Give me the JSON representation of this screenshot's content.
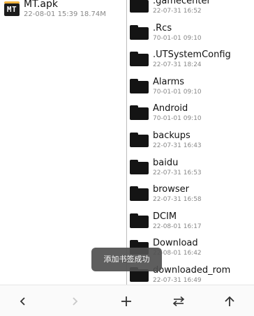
{
  "left_panel": {
    "file": {
      "name": "MT.apk",
      "meta": "22-08-01 15:39  18.74M",
      "icon": "apk-file-icon",
      "icon_text": "MT"
    }
  },
  "right_panel": {
    "folders": [
      {
        "name": ".gamecenter",
        "date": "22-07-31 16:52"
      },
      {
        "name": ".Rcs",
        "date": "70-01-01 09:10"
      },
      {
        "name": ".UTSystemConfig",
        "date": "22-07-31 18:24"
      },
      {
        "name": "Alarms",
        "date": "70-01-01 09:10"
      },
      {
        "name": "Android",
        "date": "70-01-01 09:10"
      },
      {
        "name": "backups",
        "date": "22-07-31 16:43"
      },
      {
        "name": "baidu",
        "date": "22-07-31 16:53"
      },
      {
        "name": "browser",
        "date": "22-07-31 16:58"
      },
      {
        "name": "DCIM",
        "date": "22-08-01 16:17"
      },
      {
        "name": "Download",
        "date": "22-08-01 16:42"
      },
      {
        "name": "downloaded_rom",
        "date": "22-07-31 16:49"
      }
    ]
  },
  "toast": {
    "message": "添加书签成功"
  },
  "toolbar": {
    "buttons": [
      {
        "icon": "back-arrow-icon",
        "enabled": true
      },
      {
        "icon": "forward-arrow-icon",
        "enabled": false
      },
      {
        "icon": "add-icon",
        "enabled": true
      },
      {
        "icon": "swap-panes-icon",
        "enabled": true
      },
      {
        "icon": "up-arrow-icon",
        "enabled": true
      }
    ]
  },
  "colors": {
    "folder_icon": "#141414",
    "primary_text": "#111111",
    "secondary_text": "#888888",
    "toast_bg": "#505050",
    "disabled_icon": "#c8c8c8"
  }
}
